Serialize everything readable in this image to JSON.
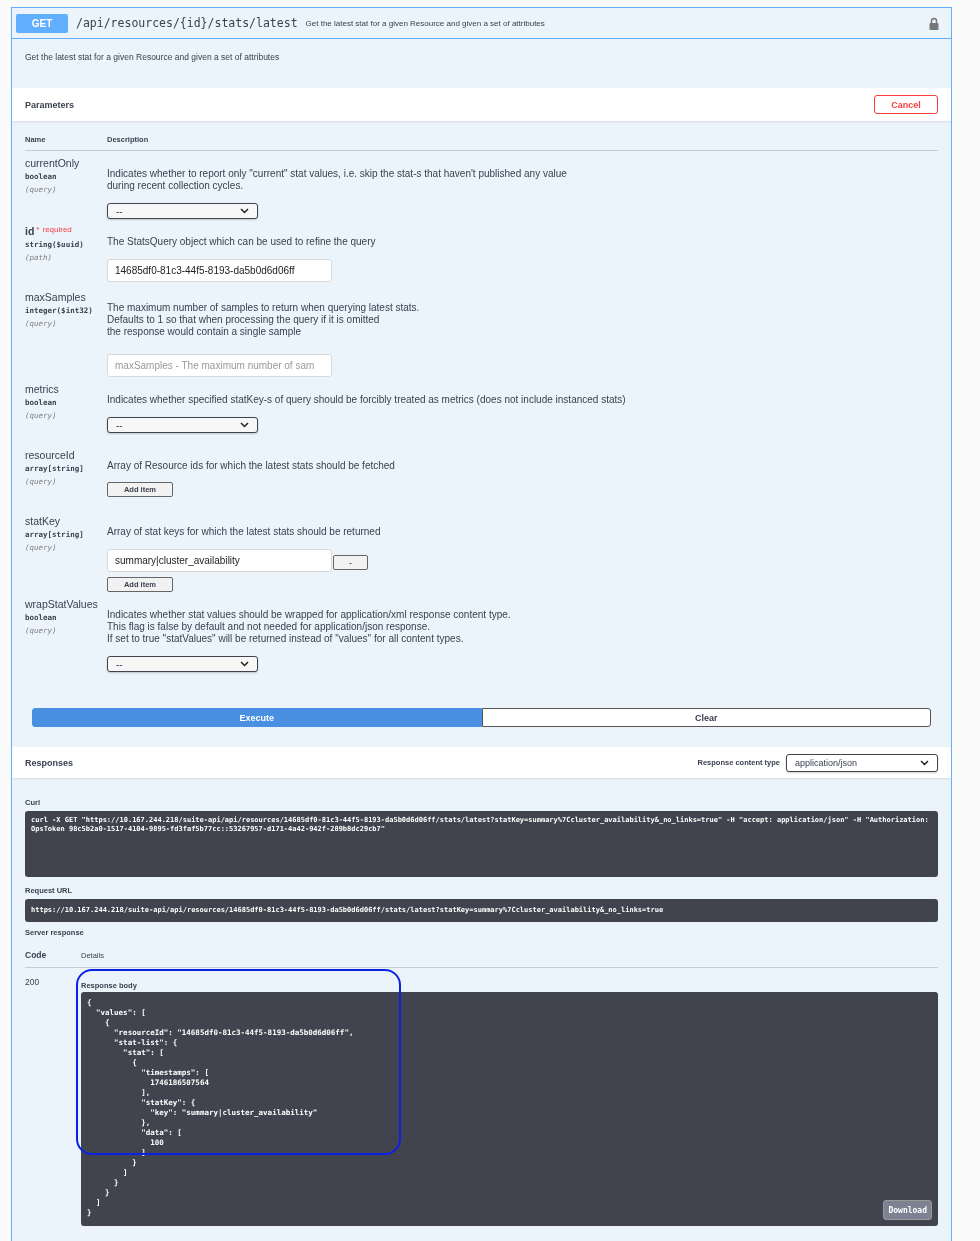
{
  "operation": {
    "method": "GET",
    "path": "/api/resources/{id}/stats/latest",
    "summary": "Get the latest stat for a given Resource and given a set of attributes",
    "locked": true
  },
  "description": "Get the latest stat for a given Resource and given a set of attributes",
  "parameters": {
    "title": "Parameters",
    "cancel_button": "Cancel",
    "columns": [
      "Name",
      "Description"
    ],
    "rows": [
      {
        "name": "currentOnly",
        "required": false,
        "type": "boolean",
        "location": "(query)",
        "description": "Indicates whether to report only \"current\" stat values, i.e. skip the stat-s that haven't published any value\nduring recent collection cycles.",
        "control": {
          "kind": "select",
          "value": "--"
        }
      },
      {
        "name": "id",
        "required": true,
        "required_mark": "*",
        "required_label": "required",
        "type": "string($uuid)",
        "location": "(path)",
        "description": "The StatsQuery object which can be used to refine the query",
        "control": {
          "kind": "input",
          "value": "14685df0-81c3-44f5-8193-da5b0d6d06ff"
        }
      },
      {
        "name": "maxSamples",
        "required": false,
        "type": "integer($int32)",
        "location": "(query)",
        "description": "The maximum number of samples to return when querying latest stats.\nDefaults to 1 so that when processing the query if it is omitted\nthe response would contain a single sample",
        "control": {
          "kind": "input",
          "placeholder": "maxSamples - The maximum number of sam"
        }
      },
      {
        "name": "metrics",
        "required": false,
        "type": "boolean",
        "location": "(query)",
        "description": "Indicates whether specified statKey-s of query should be forcibly treated as metrics (does not include instanced stats)",
        "control": {
          "kind": "select",
          "value": "--"
        }
      },
      {
        "name": "resourceId",
        "required": false,
        "type": "array[string]",
        "location": "(query)",
        "description": "Array of Resource ids for which the latest stats should be fetched",
        "control": {
          "kind": "array",
          "add_button": "Add item"
        }
      },
      {
        "name": "statKey",
        "required": false,
        "type": "array[string]",
        "location": "(query)",
        "description": "Array of stat keys for which the latest stats should be returned",
        "control": {
          "kind": "array",
          "items": [
            {
              "value": "summary|cluster_availability",
              "remove_button": "-"
            }
          ],
          "add_button": "Add item"
        }
      },
      {
        "name": "wrapStatValues",
        "required": false,
        "type": "boolean",
        "location": "(query)",
        "description": "Indicates whether stat values should be wrapped for application/xml response content type.\nThis flag is false by default and not needed for application/json response.\nIf set to true \"statValues\" will be returned instead of \"values\" for all content types.",
        "control": {
          "kind": "select",
          "value": "--"
        }
      }
    ]
  },
  "actions": {
    "execute": "Execute",
    "clear": "Clear"
  },
  "responses": {
    "title": "Responses",
    "content_type_label": "Response content type",
    "content_type": "application/json",
    "curl_label": "Curl",
    "curl": "curl -X GET \"https://10.167.244.218/suite-api/api/resources/14685df0-81c3-44f5-8193-da5b0d6d06ff/stats/latest?statKey=summary%7Ccluster_availability&_no_links=true\" -H  \"accept: application/json\" -H  \"Authorization: OpsToken 98c5b2a0-1517-4104-9895-fd3faf5b77cc::53267957-d171-4a42-942f-289b8dc29cb7\"",
    "request_url_label": "Request URL",
    "request_url": "https://10.167.244.218/suite-api/api/resources/14685df0-81c3-44f5-8193-da5b0d6d06ff/stats/latest?statKey=summary%7Ccluster_availability&_no_links=true",
    "server_response_label": "Server response",
    "code_header": "Code",
    "details_header": "Details",
    "code": "200",
    "body_label": "Response body",
    "body": "{\n  \"values\": [\n    {\n      \"resourceId\": \"14685df0-81c3-44f5-8193-da5b0d6d06ff\",\n      \"stat-list\": {\n        \"stat\": [\n          {\n            \"timestamps\": [\n              1746186507564\n            ],\n            \"statKey\": {\n              \"key\": \"summary|cluster_availability\"\n            },\n            \"data\": [\n              100\n            ]\n          }\n        ]\n      }\n    }\n  ]\n}",
    "download_button": "Download"
  },
  "annotations": [
    {
      "kind": "outline",
      "color": "#0b22e6"
    }
  ]
}
